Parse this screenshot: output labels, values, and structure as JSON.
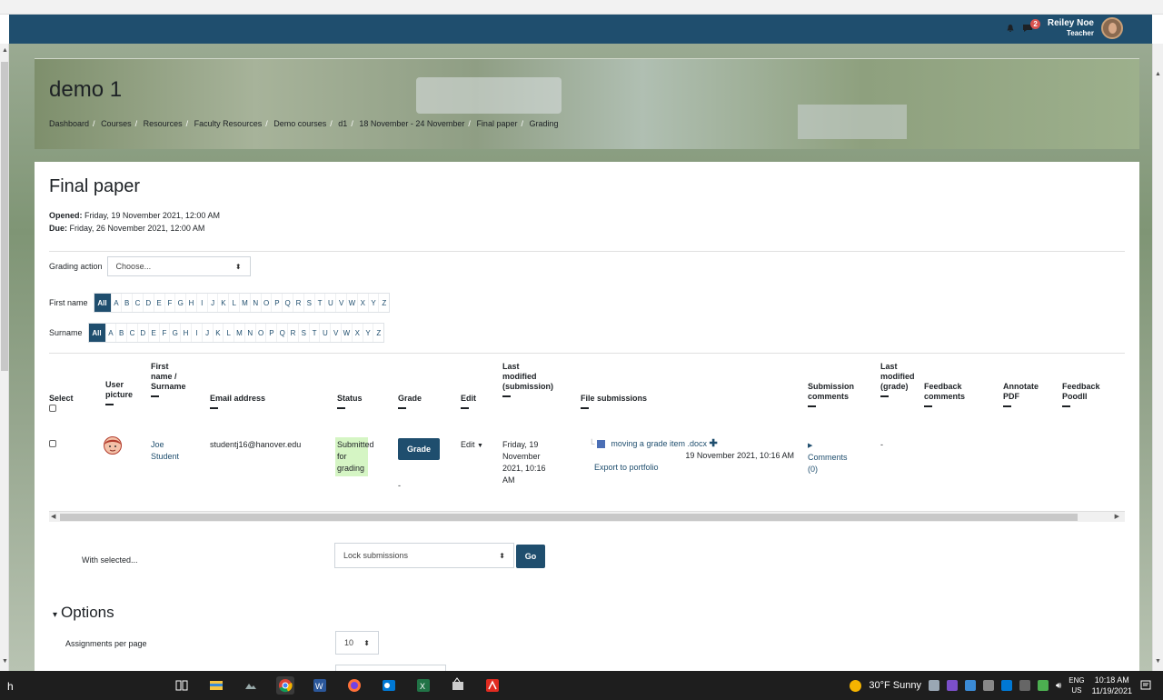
{
  "navbar": {
    "notification_count": "2",
    "user_name": "Reiley Noe",
    "user_role": "Teacher"
  },
  "course": {
    "title": "demo 1",
    "breadcrumb": [
      "Dashboard",
      "Courses",
      "Resources",
      "Faculty Resources",
      "Demo courses",
      "d1",
      "18 November - 24 November",
      "Final paper",
      "Grading"
    ]
  },
  "assignment": {
    "title": "Final paper",
    "opened_label": "Opened:",
    "opened_value": "Friday, 19 November 2021, 12:00 AM",
    "due_label": "Due:",
    "due_value": "Friday, 26 November 2021, 12:00 AM"
  },
  "grading_action": {
    "label": "Grading action",
    "value": "Choose..."
  },
  "filters": {
    "first_name_label": "First name",
    "surname_label": "Surname",
    "all_label": "All",
    "letters": [
      "A",
      "B",
      "C",
      "D",
      "E",
      "F",
      "G",
      "H",
      "I",
      "J",
      "K",
      "L",
      "M",
      "N",
      "O",
      "P",
      "Q",
      "R",
      "S",
      "T",
      "U",
      "V",
      "W",
      "X",
      "Y",
      "Z"
    ]
  },
  "table": {
    "headers": {
      "select": "Select",
      "user_picture": [
        "User",
        "picture"
      ],
      "name": [
        "First",
        "name /",
        "Surname"
      ],
      "email": "Email address",
      "status": "Status",
      "grade": "Grade",
      "edit": "Edit",
      "last_modified_submission": [
        "Last",
        "modified",
        "(submission)"
      ],
      "file_submissions": "File submissions",
      "submission_comments": [
        "Submission",
        "comments"
      ],
      "last_modified_grade": [
        "Last",
        "modified",
        "(grade)"
      ],
      "feedback_comments": [
        "Feedback",
        "comments"
      ],
      "annotate_pdf": [
        "Annotate",
        "PDF"
      ],
      "feedback_poodll": [
        "Feedback",
        "Poodll"
      ]
    },
    "row": {
      "first_name": "Joe",
      "surname": "Student",
      "email": "studentj16@hanover.edu",
      "status": [
        "Submitted",
        "for",
        "grading"
      ],
      "grade_button": "Grade",
      "grade_dash": "-",
      "edit": "Edit",
      "modified": [
        "Friday, 19",
        "November",
        "2021, 10:16",
        "AM"
      ],
      "file_name": "moving a grade item .docx",
      "file_date": "19 November 2021, 10:16 AM",
      "export": "Export to portfolio",
      "comments": [
        "Comments",
        "(0)"
      ],
      "last_modified_grade": "-"
    }
  },
  "bulk": {
    "with_selected": "With selected...",
    "action": "Lock submissions",
    "go": "Go"
  },
  "options": {
    "title": "Options",
    "per_page_label": "Assignments per page",
    "per_page_value": "10"
  },
  "taskbar": {
    "left_text": "h",
    "weather": "30°F  Sunny",
    "lang_top": "ENG",
    "lang_bottom": "US",
    "time": "10:18 AM",
    "date": "11/19/2021"
  }
}
